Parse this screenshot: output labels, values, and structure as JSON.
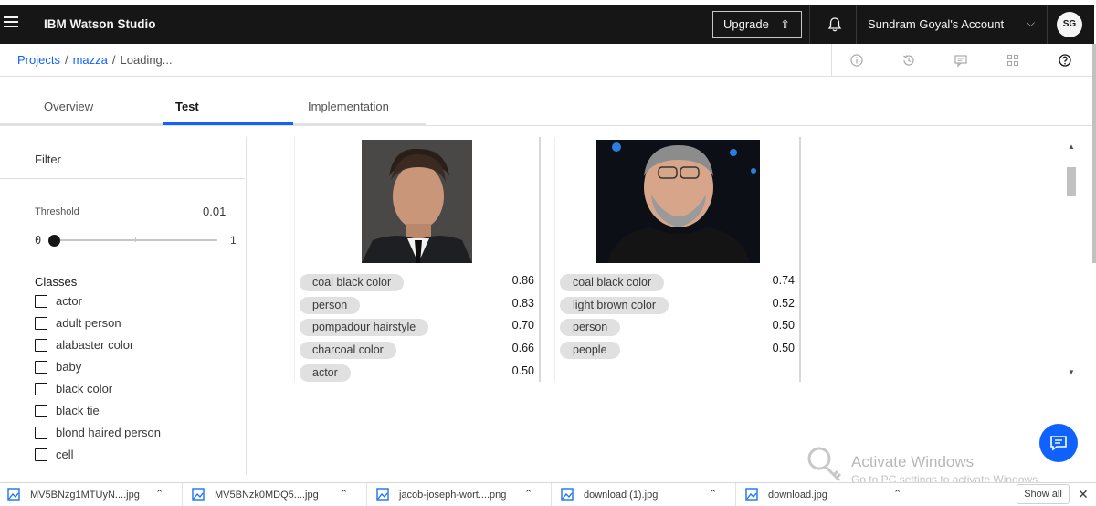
{
  "header": {
    "brand": "IBM Watson Studio",
    "upgrade_label": "Upgrade",
    "account_label": "Sundram Goyal's Account",
    "avatar_initials": "SG"
  },
  "breadcrumb": {
    "items": [
      "Projects",
      "mazza",
      "Loading..."
    ]
  },
  "tabs": [
    "Overview",
    "Test",
    "Implementation"
  ],
  "filter": {
    "title": "Filter",
    "threshold_label": "Threshold",
    "threshold_value": "0.01",
    "slider_min": "0",
    "slider_max": "1",
    "classes_title": "Classes",
    "classes": [
      "actor",
      "adult person",
      "alabaster color",
      "baby",
      "black color",
      "black tie",
      "blond haired person",
      "cell"
    ]
  },
  "results": [
    {
      "tags": [
        {
          "label": "coal black color",
          "score": "0.86"
        },
        {
          "label": "person",
          "score": "0.83"
        },
        {
          "label": "pompadour hairstyle",
          "score": "0.70"
        },
        {
          "label": "charcoal color",
          "score": "0.66"
        },
        {
          "label": "actor",
          "score": "0.50"
        }
      ]
    },
    {
      "tags": [
        {
          "label": "coal black color",
          "score": "0.74"
        },
        {
          "label": "light brown color",
          "score": "0.52"
        },
        {
          "label": "person",
          "score": "0.50"
        },
        {
          "label": "people",
          "score": "0.50"
        }
      ]
    }
  ],
  "watermark": {
    "title": "Activate Windows",
    "subtitle": "Go to PC settings to activate Windows."
  },
  "downloads": {
    "files": [
      "MV5BNzg1MTUyN....jpg",
      "MV5BNzk0MDQ5....jpg",
      "jacob-joseph-wort....png",
      "download (1).jpg",
      "download.jpg"
    ],
    "show_all_label": "Show all"
  },
  "colors": {
    "header_bg": "#161616",
    "link": "#0f62fe",
    "tab_active": "#0f62fe",
    "chat_button": "#0f62fe",
    "tag_bg": "#e0e0e0"
  }
}
